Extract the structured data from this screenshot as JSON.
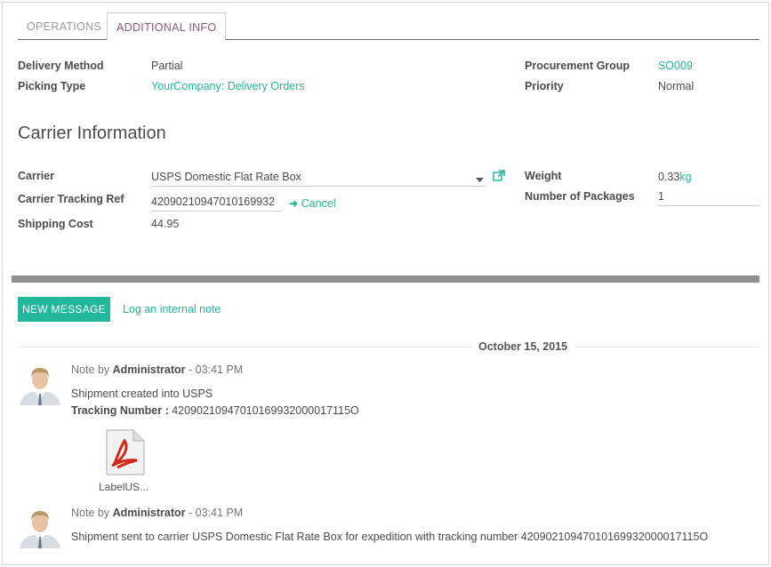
{
  "tabs": {
    "operations": "OPERATIONS",
    "additional_info": "ADDITIONAL INFO"
  },
  "fields": {
    "delivery_method": {
      "label": "Delivery Method",
      "value": "Partial"
    },
    "picking_type": {
      "label": "Picking Type",
      "value": "YourCompany: Delivery Orders"
    },
    "procurement_group": {
      "label": "Procurement Group",
      "value": "SO009"
    },
    "priority": {
      "label": "Priority",
      "value": "Normal"
    }
  },
  "carrier_section": {
    "title": "Carrier Information",
    "carrier": {
      "label": "Carrier",
      "value": "USPS Domestic Flat Rate Box"
    },
    "tracking_ref": {
      "label": "Carrier Tracking Ref",
      "value": "42090210947010169932",
      "cancel": "Cancel"
    },
    "shipping_cost": {
      "label": "Shipping Cost",
      "value": "44.95"
    },
    "weight": {
      "label": "Weight",
      "value": "0.33",
      "unit": "kg"
    },
    "packages": {
      "label": "Number of Packages",
      "value": "1"
    }
  },
  "chatter": {
    "new_message": "NEW MESSAGE",
    "log_note": "Log an internal note",
    "date": "October 15, 2015",
    "messages": [
      {
        "prefix": "Note by",
        "author": "Administrator",
        "time": "- 03:41 PM",
        "line1": "Shipment created into USPS",
        "line2_label": "Tracking Number :",
        "line2_value": " 42090210947010169932000017115O",
        "attachment": "LabelUS..."
      },
      {
        "prefix": "Note by",
        "author": "Administrator",
        "time": "- 03:41 PM",
        "line1": "Shipment sent to carrier USPS Domestic Flat Rate Box for expedition with tracking number 42090210947010169932000017115O"
      }
    ]
  },
  "colors": {
    "accent": "#21b799",
    "tab_active": "#875a7b",
    "separator": "#909090"
  }
}
